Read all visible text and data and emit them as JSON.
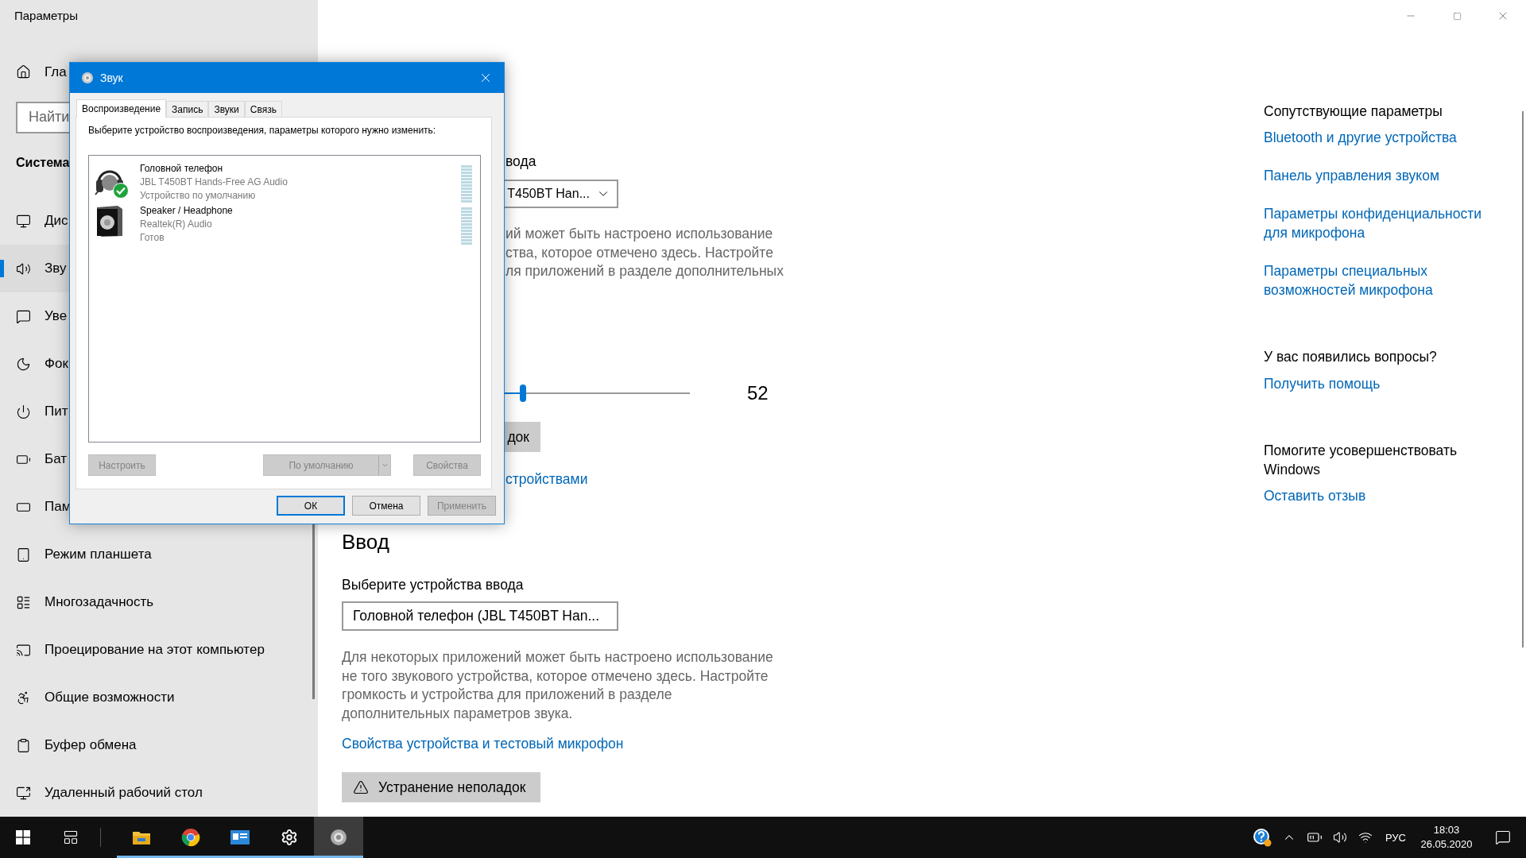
{
  "settings_window": {
    "title": "Параметры"
  },
  "sidebar": {
    "home_label": "Гла",
    "search": {
      "placeholder": "Найти"
    },
    "section_title": "Система",
    "items": [
      {
        "label": "Дис",
        "selected": false
      },
      {
        "label": "Зву",
        "selected": true
      },
      {
        "label": "Уве",
        "selected": false
      },
      {
        "label": "Фок",
        "selected": false
      },
      {
        "label": "Пит",
        "selected": false
      },
      {
        "label": "Бат",
        "selected": false
      },
      {
        "label": "Пам",
        "selected": false
      },
      {
        "label": "Режим планшета",
        "selected": false
      },
      {
        "label": "Многозадачность",
        "selected": false
      },
      {
        "label": "Проецирование на этот компьютер",
        "selected": false
      },
      {
        "label": "Общие возможности",
        "selected": false
      },
      {
        "label": "Буфер обмена",
        "selected": false
      },
      {
        "label": "Удаленный рабочий стол",
        "selected": false
      }
    ]
  },
  "output_section": {
    "device_label": "вода",
    "device_value": "T450BT Han...",
    "description_lines": [
      "ий может быть настроено использование",
      "ства, которое отмечено здесь. Настройте",
      "ля приложений в разделе дополнительных"
    ],
    "volume": {
      "level": 0.52,
      "reading": "52"
    },
    "troubleshoot_button": "док",
    "manage_link": "стройствами"
  },
  "input_section": {
    "heading": "Ввод",
    "device_label": "Выберите устройства ввода",
    "device_value": "Головной телефон (JBL T450BT Han...",
    "description": "Для некоторых приложений может быть настроено использование не того звукового устройства, которое отмечено здесь. Настройте громкость и устройства для приложений в разделе дополнительных параметров звука.",
    "properties_link": "Свойства устройства и тестовый микрофон",
    "troubleshoot_button": "Устранение неполадок"
  },
  "related": {
    "heading": "Сопутствующие параметры",
    "links": [
      "Bluetooth и другие устройства",
      "Панель управления звуком",
      "Параметры конфиденциальности для микрофона",
      "Параметры специальных возможностей микрофона"
    ],
    "questions_heading": "У вас появились вопросы?",
    "help_link": "Получить помощь",
    "improve_heading": "Помогите усовершенствовать Windows",
    "feedback_link": "Оставить отзыв"
  },
  "sound_dialog": {
    "title": "Звук",
    "tabs": [
      {
        "label": "Воспроизведение",
        "selected": true
      },
      {
        "label": "Запись",
        "selected": false
      },
      {
        "label": "Звуки",
        "selected": false
      },
      {
        "label": "Связь",
        "selected": false
      }
    ],
    "instruction": "Выберите устройство воспроизведения, параметры которого нужно изменить:",
    "devices": [
      {
        "kind": "headset",
        "name": "Головной телефон",
        "driver": "JBL T450BT Hands-Free AG Audio",
        "status": "Устройство по умолчанию",
        "default": true
      },
      {
        "kind": "speaker",
        "name": "Speaker / Headphone",
        "driver": "Realtek(R) Audio",
        "status": "Готов",
        "default": false
      }
    ],
    "actions": [
      {
        "kind": "push",
        "label": "Настроить",
        "disabled": true
      },
      {
        "kind": "split",
        "label": "По умолчанию",
        "disabled": true
      },
      {
        "kind": "push",
        "label": "Свойства",
        "disabled": true
      }
    ],
    "buttons": [
      {
        "label": "ОК",
        "default": true,
        "disabled": false
      },
      {
        "label": "Отмена",
        "default": false,
        "disabled": false
      },
      {
        "label": "Применить",
        "default": false,
        "disabled": true
      }
    ]
  },
  "taskbar": {
    "apps": [
      {
        "kind": "folder",
        "running": true,
        "selected": false
      },
      {
        "kind": "browser",
        "running": true,
        "selected": false
      },
      {
        "kind": "card",
        "running": true,
        "selected": false
      },
      {
        "kind": "gear",
        "running": true,
        "selected": false
      },
      {
        "kind": "speaker",
        "running": true,
        "selected": true
      }
    ],
    "language": "РУС",
    "time": "18:03",
    "date": "26.05.2020"
  }
}
